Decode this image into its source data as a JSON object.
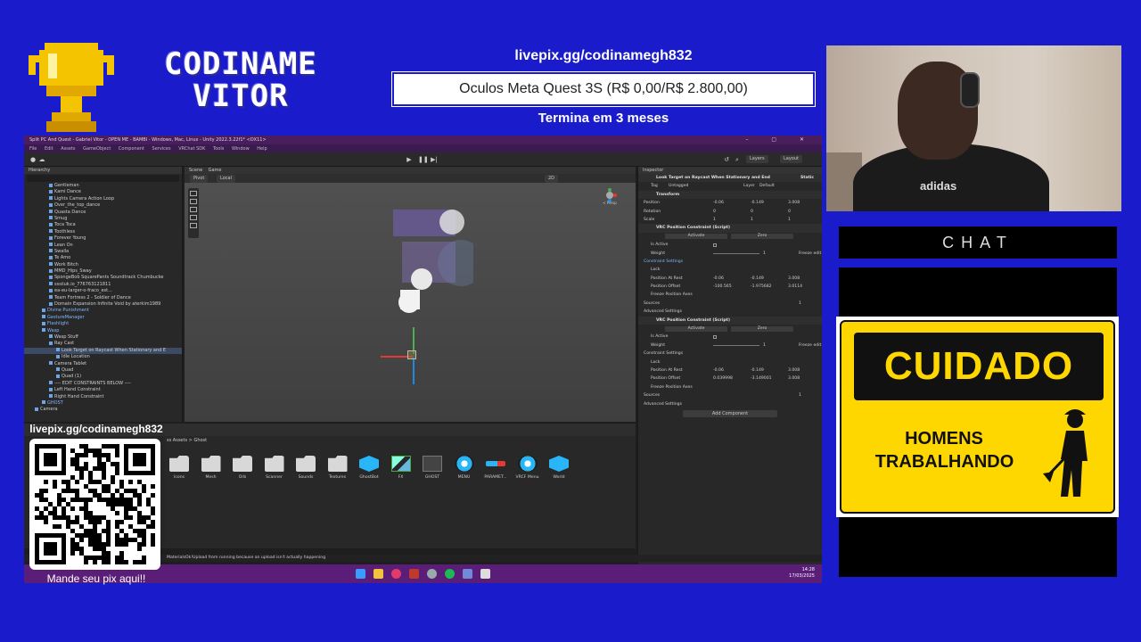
{
  "overlay": {
    "brand_line1": "CODINAME",
    "brand_line2": "VITOR",
    "goal_url": "livepix.gg/codinamegh832",
    "goal_text": "Oculos Meta Quest 3S (R$ 0,00/R$ 2.800,00)",
    "goal_progress": 0,
    "goal_time": "Termina em 3 meses",
    "qr_url": "livepix.gg/codinamegh832",
    "qr_caption": "Mande seu pix aqui!!",
    "chat_label": "CHAT",
    "sign_top": "CUIDADO",
    "sign_line1": "HOMENS",
    "sign_line2": "TRABALHANDO",
    "shirt_logo": "adidas",
    "colors": {
      "background": "#1a1ccc",
      "sign_yellow": "#ffd700"
    }
  },
  "unity": {
    "title": "Split PC And Quest - Gabriel Vitor - OPEN ME - BAMBI - Windows, Mac, Linux - Unity 2022.3.22f1* <DX11>",
    "menu": [
      "File",
      "Edit",
      "Assets",
      "GameObject",
      "Component",
      "Services",
      "VRChat SDK",
      "Tools",
      "Window",
      "Help"
    ],
    "toolbar": {
      "pivot": "Pivot",
      "local": "Local",
      "layers": "Layers",
      "layout": "Layout",
      "mode_2d": "2D"
    },
    "hierarchy": {
      "tab": "Hierarchy",
      "items": [
        {
          "label": "Gentleman",
          "indent": 3,
          "sel": false
        },
        {
          "label": "Kami Dance",
          "indent": 3,
          "sel": false
        },
        {
          "label": "Lights Camera Action Loop",
          "indent": 3,
          "sel": false
        },
        {
          "label": "Over_the_top_dance",
          "indent": 3,
          "sel": false
        },
        {
          "label": "Quasta Dance",
          "indent": 3,
          "sel": false
        },
        {
          "label": "Smug",
          "indent": 3,
          "sel": false
        },
        {
          "label": "Toca Toca",
          "indent": 3,
          "sel": false
        },
        {
          "label": "Toothless",
          "indent": 3,
          "sel": false
        },
        {
          "label": "Forever Young",
          "indent": 3,
          "sel": false
        },
        {
          "label": "Lean On",
          "indent": 3,
          "sel": false
        },
        {
          "label": "Swalla",
          "indent": 3,
          "sel": false
        },
        {
          "label": "Te Amo",
          "indent": 3,
          "sel": false
        },
        {
          "label": "Work Bitch",
          "indent": 3,
          "sel": false
        },
        {
          "label": "MMD_Hips_Sway",
          "indent": 3,
          "sel": false
        },
        {
          "label": "SpongeBob SquarePants Soundtrack Chumbucke",
          "indent": 3,
          "sel": false
        },
        {
          "label": "sssiiuk.io_776763121811",
          "indent": 3,
          "sel": false
        },
        {
          "label": "ea-eu-larger-o-fraco_est...",
          "indent": 3,
          "sel": false
        },
        {
          "label": "Team Fortress 2 - Soldier of Dance",
          "indent": 3,
          "sel": false
        },
        {
          "label": "Domain Expansion Infinite Void by aterkim1989",
          "indent": 3,
          "sel": false
        },
        {
          "label": "Divine Punishment",
          "indent": 2,
          "sel": false,
          "blue": true
        },
        {
          "label": "GestureManager",
          "indent": 2,
          "sel": false,
          "blue": true
        },
        {
          "label": "Flashlight",
          "indent": 2,
          "sel": false,
          "blue": true
        },
        {
          "label": "Wasp",
          "indent": 2,
          "sel": false,
          "blue": true
        },
        {
          "label": "Wasp Stuff",
          "indent": 3,
          "sel": false
        },
        {
          "label": "Ray Cast",
          "indent": 3,
          "sel": false
        },
        {
          "label": "Look Target on Raycast When Stationary and E",
          "indent": 4,
          "sel": true
        },
        {
          "label": "Idle Location",
          "indent": 4,
          "sel": false
        },
        {
          "label": "Camera Tablet",
          "indent": 3,
          "sel": false
        },
        {
          "label": "Quad",
          "indent": 4,
          "sel": false
        },
        {
          "label": "Quad (1)",
          "indent": 4,
          "sel": false
        },
        {
          "label": "---- EDIT CONSTRAINTS BELOW ----",
          "indent": 3,
          "sel": false
        },
        {
          "label": "Left Hand Constraint",
          "indent": 3,
          "sel": false
        },
        {
          "label": "Right Hand Constraint",
          "indent": 3,
          "sel": false
        },
        {
          "label": "GHOST",
          "indent": 2,
          "sel": false,
          "blue": true
        },
        {
          "label": "Camera",
          "indent": 1,
          "sel": false
        }
      ]
    },
    "scene": {
      "tab_scene": "Scene",
      "tab_game": "Game",
      "persp_label": "< Persp"
    },
    "inspector": {
      "tab": "Inspector",
      "object_name": "Look Target on Raycast When Stationary and End",
      "static_label": "Static",
      "tag_label": "Tag",
      "tag_value": "Untagged",
      "layer_label": "Layer",
      "layer_value": "Default",
      "transform_header": "Transform",
      "position_label": "Position",
      "rotation_label": "Rotation",
      "scale_label": "Scale",
      "position": [
        "-0.06",
        "-0.149",
        "3.008"
      ],
      "rotation": [
        "0",
        "0",
        "0"
      ],
      "scale": [
        "1",
        "1",
        "1"
      ],
      "constraint1": {
        "header": "VRC Position Constraint (Script)",
        "is_active": "Is Active",
        "activate": "Activate",
        "zero": "Zero",
        "weight": "Weight",
        "weight_value": "1",
        "freeze_edit": "Freeze edit",
        "settings": "Constraint Settings",
        "lock": "Lock",
        "par_label": "Position At Rest",
        "par": [
          "-0.06",
          "-0.149",
          "3.008"
        ],
        "po_label": "Position Offset",
        "po": [
          "-100.565",
          "-1.975682",
          "3.0114"
        ],
        "fpa": "Freeze Position Axes",
        "sources": "Sources",
        "sources_count": "1",
        "advanced": "Advanced Settings"
      },
      "constraint2": {
        "header": "VRC Position Constraint (Script)",
        "is_active": "Is Active",
        "activate": "Activate",
        "zero": "Zero",
        "weight": "Weight",
        "weight_value": "1",
        "freeze_edit": "Freeze edit",
        "settings": "Constraint Settings",
        "lock": "Lock",
        "par_label": "Position At Rest",
        "par": [
          "-0.06",
          "-0.149",
          "3.008"
        ],
        "po_label": "Position Offset",
        "po": [
          "0.039998",
          "-3.149001",
          "3.008"
        ],
        "fpa": "Freeze Position Axes",
        "sources": "Sources",
        "sources_count": "1",
        "advanced": "Advanced Settings"
      },
      "add_component": "Add Component"
    },
    "project": {
      "path": "ss Assets > Ghost",
      "assets": [
        {
          "name": "Icons",
          "kind": "folder"
        },
        {
          "name": "Mesh",
          "kind": "folder"
        },
        {
          "name": "Orb",
          "kind": "folder"
        },
        {
          "name": "Scanner",
          "kind": "folder"
        },
        {
          "name": "Sounds",
          "kind": "folder"
        },
        {
          "name": "Textures",
          "kind": "folder"
        },
        {
          "name": "GhostBot",
          "kind": "cube"
        },
        {
          "name": "FX",
          "kind": "cubes"
        },
        {
          "name": "GHOST",
          "kind": "dots"
        },
        {
          "name": "MENU",
          "kind": "ring"
        },
        {
          "name": "PARAMET...",
          "kind": "bar"
        },
        {
          "name": "VRCF Menu",
          "kind": "ring"
        },
        {
          "name": "World",
          "kind": "cube"
        }
      ]
    },
    "status": "MaterialsOk!Upload from running because an upload isn't actually happening",
    "tray_time": "14:28",
    "tray_date": "17/03/2025"
  }
}
